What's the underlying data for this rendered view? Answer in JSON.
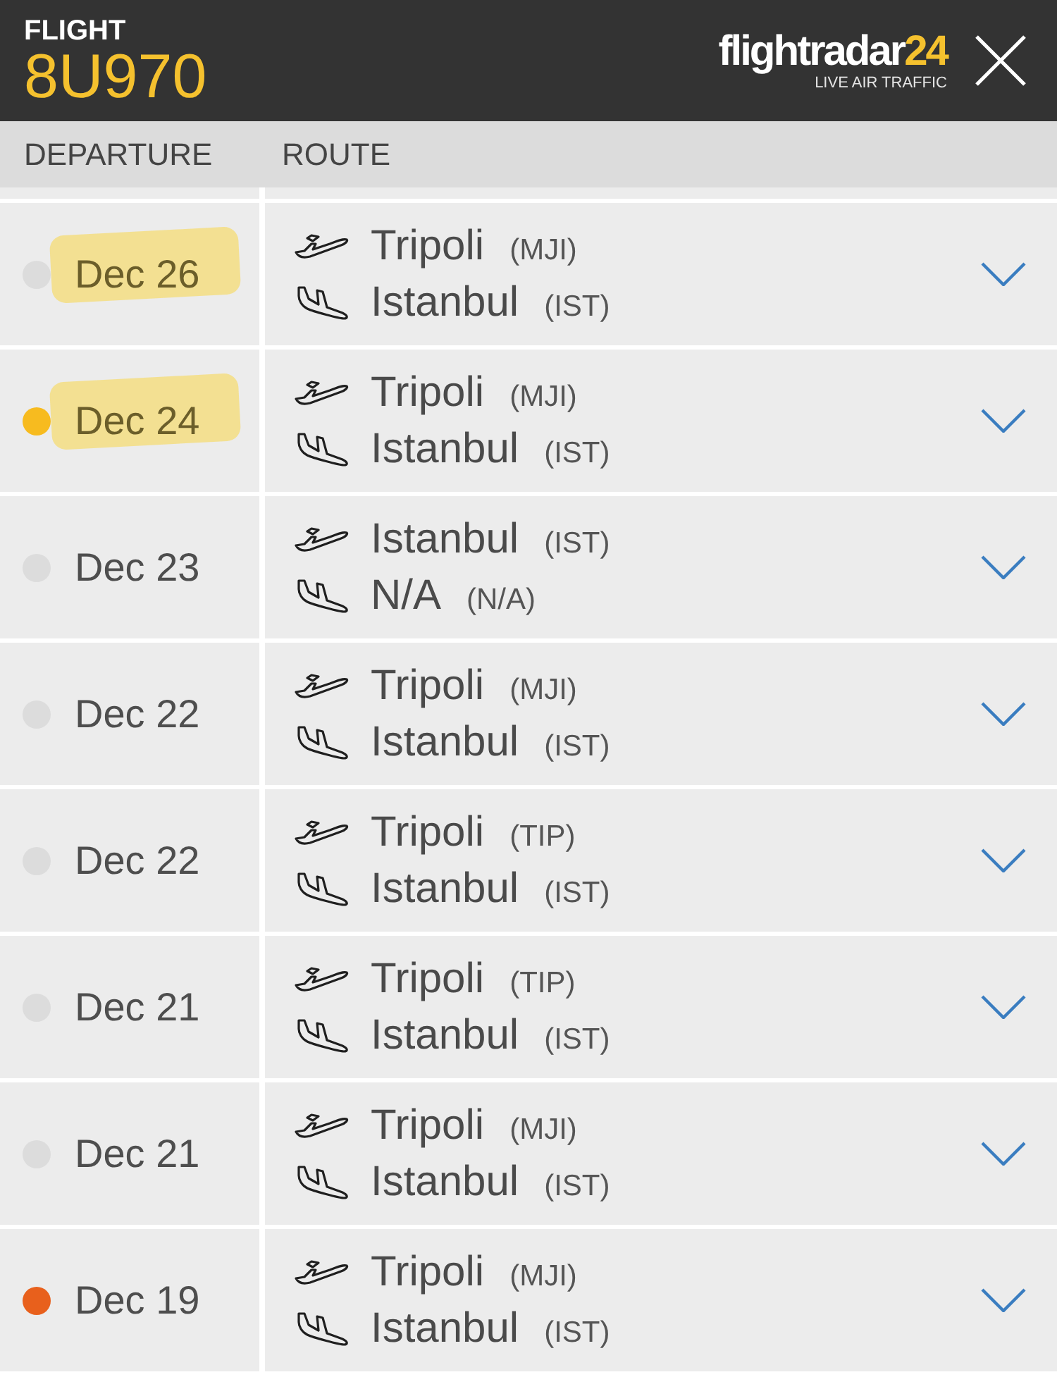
{
  "header": {
    "label": "FLIGHT",
    "flight_number": "8U970",
    "logo": {
      "name": "flightradar",
      "number": "24",
      "tagline": "LIVE AIR TRAFFIC"
    }
  },
  "columns": [
    "DEPARTURE",
    "ROUTE"
  ],
  "flights": [
    {
      "date": "Dec 26",
      "color": "#dcdcdc",
      "highlighted": true,
      "expanded": false,
      "from": {
        "city": "Tripoli",
        "code": "(MJI)"
      },
      "to": {
        "city": "Istanbul",
        "code": "(IST)"
      }
    },
    {
      "date": "Dec 24",
      "color": "#f7bb1f",
      "highlighted": true,
      "expanded": false,
      "from": {
        "city": "Tripoli",
        "code": "(MJI)"
      },
      "to": {
        "city": "Istanbul",
        "code": "(IST)"
      }
    },
    {
      "date": "Dec 23",
      "color": "#dcdcdc",
      "highlighted": false,
      "expanded": false,
      "from": {
        "city": "Istanbul",
        "code": "(IST)"
      },
      "to": {
        "city": "N/A",
        "code": "(N/A)"
      }
    },
    {
      "date": "Dec 22",
      "color": "#dcdcdc",
      "highlighted": false,
      "expanded": false,
      "from": {
        "city": "Tripoli",
        "code": "(MJI)"
      },
      "to": {
        "city": "Istanbul",
        "code": "(IST)"
      }
    },
    {
      "date": "Dec 22",
      "color": "#dcdcdc",
      "highlighted": false,
      "expanded": false,
      "from": {
        "city": "Tripoli",
        "code": "(TIP)"
      },
      "to": {
        "city": "Istanbul",
        "code": "(IST)"
      }
    },
    {
      "date": "Dec 21",
      "color": "#dcdcdc",
      "highlighted": false,
      "expanded": false,
      "from": {
        "city": "Tripoli",
        "code": "(TIP)"
      },
      "to": {
        "city": "Istanbul",
        "code": "(IST)"
      }
    },
    {
      "date": "Dec 21",
      "color": "#dcdcdc",
      "highlighted": false,
      "expanded": false,
      "from": {
        "city": "Tripoli",
        "code": "(MJI)"
      },
      "to": {
        "city": "Istanbul",
        "code": "(IST)"
      }
    },
    {
      "date": "Dec 19",
      "color": "#e8601c",
      "highlighted": false,
      "expanded": false,
      "from": {
        "city": "Tripoli",
        "code": "(MJI)"
      },
      "to": {
        "city": "Istanbul",
        "code": "(IST)"
      }
    }
  ]
}
